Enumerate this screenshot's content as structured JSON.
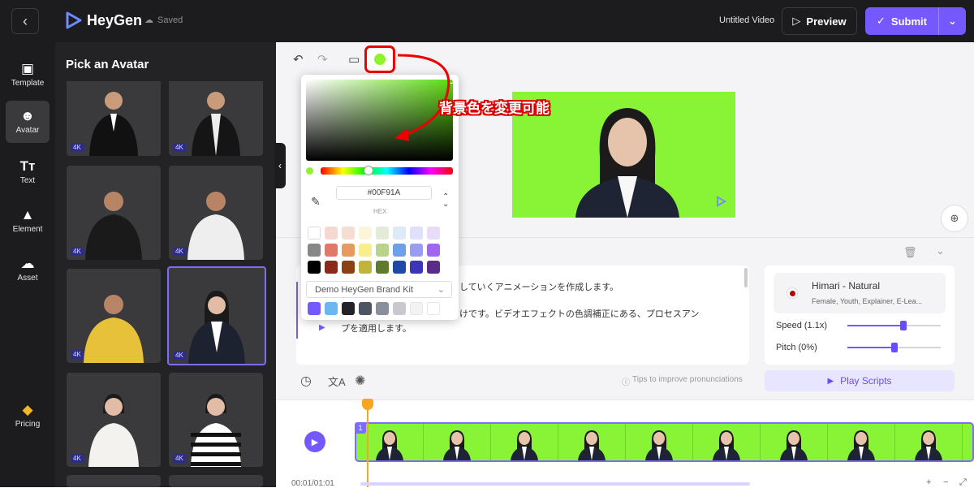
{
  "app": {
    "name": "HeyGen",
    "saved_label": "Saved",
    "video_title": "Untitled Video"
  },
  "header": {
    "preview_label": "Preview",
    "submit_label": "Submit"
  },
  "nav": [
    {
      "label": "Template",
      "icon": "template-icon"
    },
    {
      "label": "Avatar",
      "icon": "avatar-icon",
      "active": true
    },
    {
      "label": "Text",
      "icon": "text-icon"
    },
    {
      "label": "Element",
      "icon": "element-icon"
    },
    {
      "label": "Asset",
      "icon": "asset-icon"
    },
    {
      "label": "Pricing",
      "icon": "diamond-icon"
    }
  ],
  "panel": {
    "title": "Pick an Avatar",
    "badge": "4K",
    "avatars": [
      "suit-man",
      "white-shirt-man",
      "black-tee-man",
      "white-tee-man",
      "yellow-sweater-man",
      "blazer-woman",
      "white-dress-woman",
      "striped-top-woman"
    ],
    "selected_index": 5
  },
  "color_picker": {
    "hex_value": "#00F91A",
    "hex_label": "HEX",
    "brand_kit": "Demo HeyGen Brand Kit",
    "selected_color": "#8ff32a",
    "palette": [
      "#ffffff",
      "#f6d8d3",
      "#f5ddd3",
      "#fbf6da",
      "#e4ecd9",
      "#dcebf7",
      "#dfe0fb",
      "#e8dcf9",
      "#888888",
      "#e0796a",
      "#e8995d",
      "#f8ef8c",
      "#b9d38a",
      "#6ea0e9",
      "#9a9cf2",
      "#a266ee",
      "#000000",
      "#8b2a18",
      "#8b4212",
      "#c0b43a",
      "#5f7a2a",
      "#1f4aa4",
      "#3c35b7",
      "#5c2b8a"
    ],
    "brand_colors": [
      "#7559ff",
      "#6cb6f2",
      "#222228",
      "#4f5463",
      "#8a8f9c",
      "#c8c9ce",
      "#f3f3f5",
      "#ffffff"
    ]
  },
  "annotation": "背景色を変更可能",
  "script": {
    "line1": "していくアニメーションを作成します。",
    "line2": "けです。ビデオエフェクトの色調補正にある、プロセスアン",
    "line3": "プを適用します。",
    "tips": "Tips to improve pronunciations"
  },
  "voice": {
    "name": "Himari - Natural",
    "tags": "Female, Youth, Explainer, E-Lea...",
    "speed_label": "Speed (1.1x)",
    "speed_value": 0.6,
    "pitch_label": "Pitch (0%)",
    "pitch_value": 0.5,
    "play_label": "Play Scripts"
  },
  "timeline": {
    "timecode": "00:01/01:01",
    "scene_number": "1"
  },
  "colors": {
    "accent": "#7559ff",
    "canvas_bg": "#89f336",
    "playhead": "#f5a623"
  }
}
